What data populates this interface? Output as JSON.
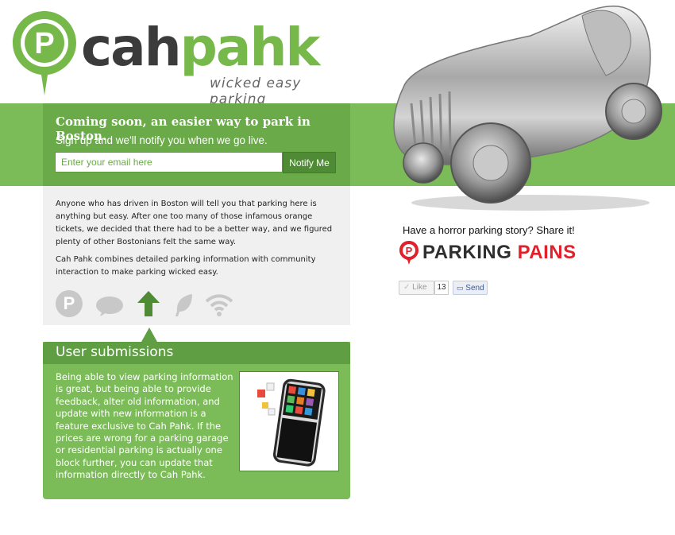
{
  "brand": {
    "logo_cah": "cah",
    "logo_pahk": "pahk",
    "logo_mark": "P",
    "tagline": "wicked easy parking",
    "green": "#7cbc58",
    "dark_green": "#5f9e43",
    "red": "#e2202b"
  },
  "signup": {
    "title": "Coming soon, an easier way to park in Boston.",
    "subtitle": "Sign up and we'll notify you when we go live.",
    "email_placeholder": "Enter your email here",
    "button_label": "Notify Me"
  },
  "about": {
    "paragraph1": "Anyone who has driven in Boston will tell you that parking here is anything but easy. After one too many of those infamous orange tickets, we decided that there had to be a better way, and we figured plenty of other Bostonians felt the same way.",
    "paragraph2": "Cah Pahk combines detailed parking information with community interaction to make parking wicked easy.",
    "feature_icons": [
      "parking-icon",
      "chat-bubble-icon",
      "arrow-up-icon",
      "leaf-icon",
      "wifi-signal-icon"
    ],
    "active_feature": "arrow-up-icon"
  },
  "submissions": {
    "title": "User submissions",
    "body": "Being able to view parking information is great, but being able to provide feedback, alter old information, and update with new information is a feature exclusive to Cah Pahk. If the prices are wrong for a parking garage or residential parking is actually one block further, you can update that information directly to Cah Pahk.",
    "image": "smartphone-illustration"
  },
  "hero_image": "silver-toy-race-car",
  "parking_pains": {
    "prompt": "Have a horror parking story? Share it!",
    "logo_word1": "PARKING",
    "logo_word2": "PAINS",
    "logo_mark": "P"
  },
  "facebook": {
    "like_label": "Like",
    "like_count": "13",
    "send_label": "Send"
  }
}
